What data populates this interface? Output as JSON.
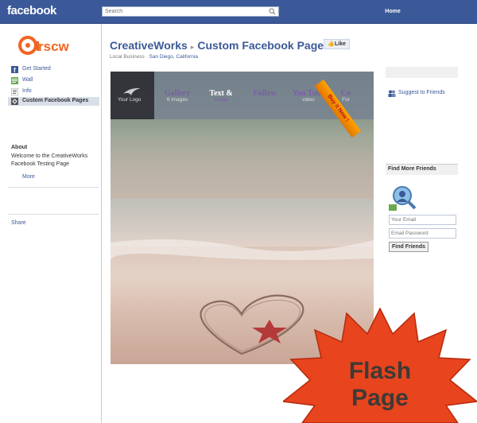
{
  "topbar": {
    "brand": "facebook",
    "search_placeholder": "Search",
    "home_label": "Home"
  },
  "sidebar": {
    "logo_text": "rscw",
    "items": [
      {
        "label": "Get Started",
        "icon": "facebook-icon"
      },
      {
        "label": "Wall",
        "icon": "wall-icon"
      },
      {
        "label": "Info",
        "icon": "info-icon"
      },
      {
        "label": "Custom Facebook Pages",
        "icon": "pages-icon",
        "active": true
      }
    ],
    "about_heading": "About",
    "about_text": "Welcome to the CreativeWorks Facebook Testing Page",
    "more_label": "More",
    "share_label": "Share"
  },
  "page": {
    "name": "CreativeWorks",
    "sub_name": "Custom Facebook Pages",
    "like_label": "Like",
    "category": "Local Business",
    "location": "San Diego, California"
  },
  "flash": {
    "logo_text": "Your    Logo",
    "nav": [
      {
        "label": "Gallery",
        "sub": "6 images"
      },
      {
        "label": "Text &",
        "sub": "image"
      },
      {
        "label": "Follow",
        "sub": ""
      },
      {
        "label": "You Tube",
        "sub": "video"
      },
      {
        "label": "Co",
        "sub": "For"
      }
    ],
    "ribbon": "Buy it Now !"
  },
  "right": {
    "suggest_label": "Suggest to Friends",
    "find_heading": "Find More Friends",
    "email_placeholder": "Your Email",
    "password_placeholder": "Email Password",
    "find_button": "Find Friends"
  },
  "badge": {
    "line1": "Flash",
    "line2": "Page",
    "color": "#e8441e"
  }
}
